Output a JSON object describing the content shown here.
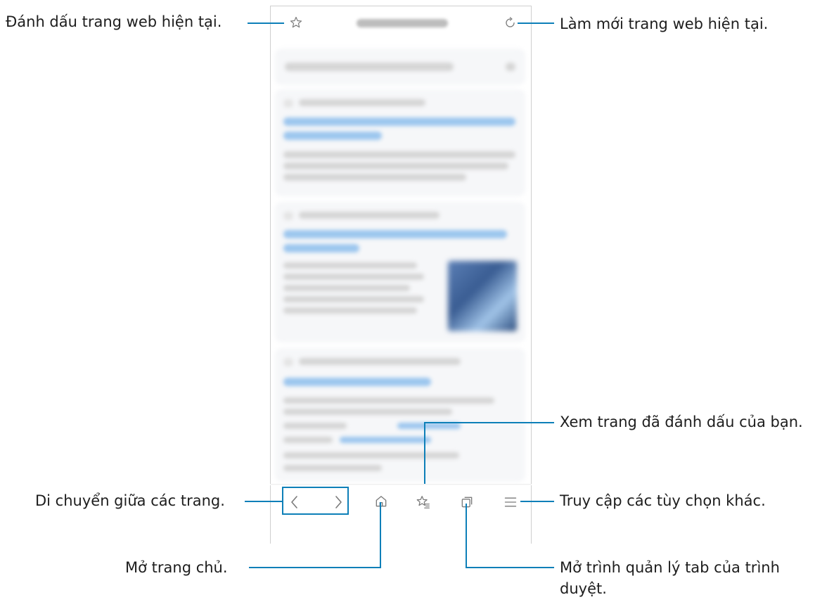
{
  "callouts": {
    "bookmark_current": "Đánh dấu trang web hiện tại.",
    "refresh": "Làm mới trang web hiện tại.",
    "view_bookmarks": "Xem trang đã đánh dấu của bạn.",
    "navigate": "Di chuyển giữa các trang.",
    "more_options": "Truy cập các tùy chọn khác.",
    "home": "Mở trang chủ.",
    "tab_manager_line1": "Mở trình quản lý tab của trình",
    "tab_manager_line2": "duyệt."
  },
  "colors": {
    "callout_line": "#0d7fb8",
    "icon": "#7a7a7a",
    "frame": "#cfcfcf"
  },
  "icons": {
    "bookmark_add": "star-outline-icon",
    "refresh": "refresh-icon",
    "back": "chevron-left-icon",
    "forward": "chevron-right-icon",
    "home": "home-icon",
    "bookmarks": "star-list-icon",
    "tabs": "tabs-icon",
    "menu": "hamburger-menu-icon"
  }
}
